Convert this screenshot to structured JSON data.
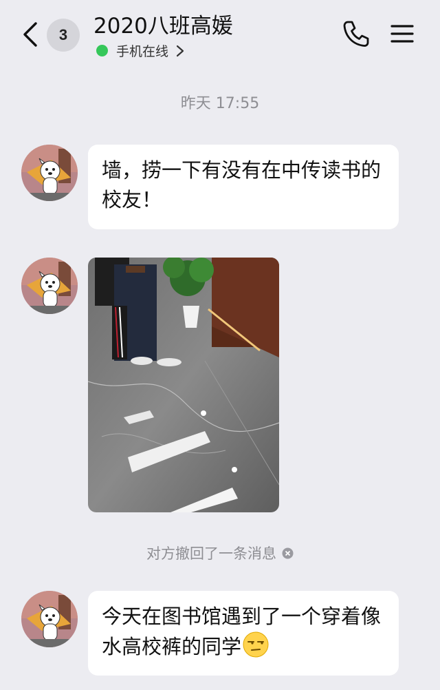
{
  "header": {
    "unread_count": "3",
    "title": "2020八班高媛",
    "status_text": "手机在线",
    "icons": [
      "back-icon",
      "phone-icon",
      "menu-icon",
      "chevron-right-icon"
    ],
    "status_color": "#35C75A"
  },
  "chat": {
    "timestamp": "昨天 17:55",
    "messages": [
      {
        "type": "text",
        "text": "墙，捞一下有没有在中传读书的校友！"
      },
      {
        "type": "image",
        "alt": ""
      },
      {
        "type": "system",
        "text": "对方撤回了一条消息"
      },
      {
        "type": "text",
        "text": "今天在图书馆遇到了一个穿着像水高校裤的同学",
        "emoji": "unamused-face-emoji"
      }
    ]
  },
  "colors": {
    "background": "#ECECF1",
    "bubble": "#FFFFFF",
    "muted_text": "#8E8E93"
  }
}
